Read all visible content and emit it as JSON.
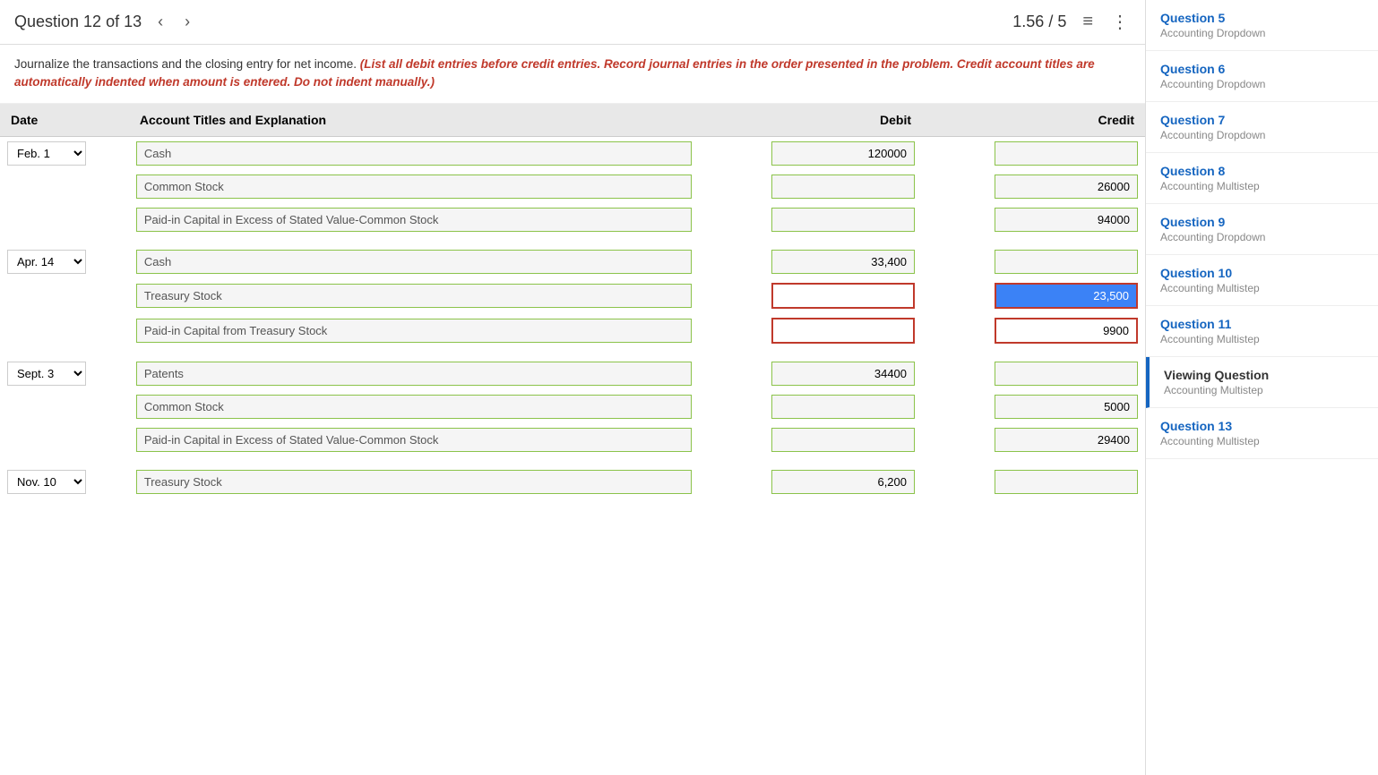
{
  "header": {
    "question_label": "Question 12 of 13",
    "score": "1.56 / 5",
    "nav_prev": "‹",
    "nav_next": "›"
  },
  "instructions": {
    "main": "Journalize the transactions and the closing entry for net income.",
    "warning": "(List all debit entries before credit entries. Record journal entries in the order presented in the problem. Credit account titles are automatically indented when amount is entered. Do not indent manually.)"
  },
  "table": {
    "columns": [
      "Date",
      "Account Titles and Explanation",
      "Debit",
      "Credit"
    ],
    "rows": [
      {
        "date": "Feb. 1",
        "date_value": "feb1",
        "account": "Cash",
        "debit": "120000",
        "credit": "",
        "debit_error": false,
        "credit_error": false
      },
      {
        "date": "",
        "account": "Common Stock",
        "debit": "",
        "credit": "26000",
        "debit_error": false,
        "credit_error": false
      },
      {
        "date": "",
        "account": "Paid-in Capital in Excess of Stated Value-Common Stock",
        "debit": "",
        "credit": "94000",
        "debit_error": false,
        "credit_error": false
      },
      {
        "date": "Apr. 14",
        "date_value": "apr14",
        "account": "Cash",
        "debit": "33,400",
        "credit": "",
        "debit_error": false,
        "credit_error": false
      },
      {
        "date": "",
        "account": "Treasury Stock",
        "debit": "",
        "credit": "23,500",
        "debit_error": true,
        "credit_error": true,
        "credit_selected": true
      },
      {
        "date": "",
        "account": "Paid-in Capital from Treasury Stock",
        "debit": "",
        "credit": "9900",
        "debit_error": true,
        "credit_error": true
      },
      {
        "date": "Sept. 3",
        "date_value": "sept3",
        "account": "Patents",
        "debit": "34400",
        "credit": "",
        "debit_error": false,
        "credit_error": false
      },
      {
        "date": "",
        "account": "Common Stock",
        "debit": "",
        "credit": "5000",
        "debit_error": false,
        "credit_error": false
      },
      {
        "date": "",
        "account": "Paid-in Capital in Excess of Stated Value-Common Stock",
        "debit": "",
        "credit": "29400",
        "debit_error": false,
        "credit_error": false
      },
      {
        "date": "Nov. 10",
        "date_value": "nov10",
        "account": "Treasury Stock",
        "debit": "6,200",
        "credit": "",
        "debit_error": false,
        "credit_error": false
      }
    ]
  },
  "sidebar": {
    "items": [
      {
        "id": "q5",
        "title": "Question 5",
        "subtitle": "Accounting Dropdown",
        "active": false
      },
      {
        "id": "q6",
        "title": "Question 6",
        "subtitle": "Accounting Dropdown",
        "active": false
      },
      {
        "id": "q7",
        "title": "Question 7",
        "subtitle": "Accounting Dropdown",
        "active": false
      },
      {
        "id": "q8",
        "title": "Question 8",
        "subtitle": "Accounting Multistep",
        "active": false
      },
      {
        "id": "q9",
        "title": "Question 9",
        "subtitle": "Accounting Dropdown",
        "active": false
      },
      {
        "id": "q10",
        "title": "Question 10",
        "subtitle": "Accounting Multistep",
        "active": false
      },
      {
        "id": "q11",
        "title": "Question 11",
        "subtitle": "Accounting Multistep",
        "active": false
      },
      {
        "id": "q12",
        "title": "Viewing Question",
        "subtitle": "Accounting Multistep",
        "active": true
      },
      {
        "id": "q13",
        "title": "Question 13",
        "subtitle": "Accounting Multistep",
        "active": false
      }
    ]
  }
}
